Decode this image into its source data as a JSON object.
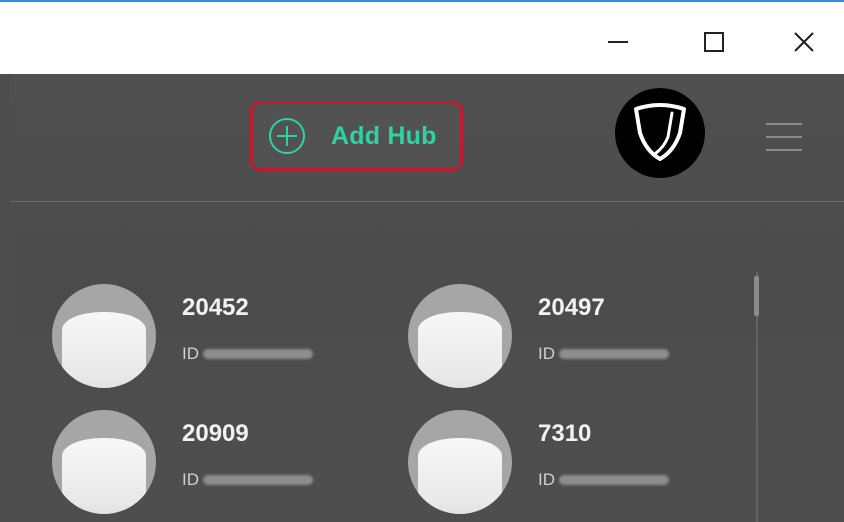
{
  "window": {
    "minimize_icon": "minimize-icon",
    "maximize_icon": "maximize-icon",
    "close_icon": "close-icon",
    "accent_color": "#2b8fd6"
  },
  "header": {
    "add_hub_label": "Add Hub",
    "add_hub_icon": "plus-circle-icon",
    "add_hub_color": "#2ed3a0",
    "highlight_color": "#c21a2f",
    "logo_icon": "shield-icon",
    "menu_icon": "hamburger-menu-icon"
  },
  "hubs": [
    {
      "name": "20452",
      "id_prefix": "ID"
    },
    {
      "name": "20497",
      "id_prefix": "ID"
    },
    {
      "name": "20909",
      "id_prefix": "ID"
    },
    {
      "name": "7310",
      "id_prefix": "ID"
    }
  ]
}
